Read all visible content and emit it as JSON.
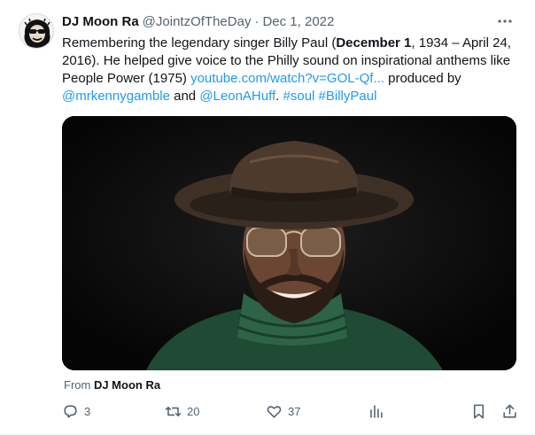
{
  "tweet": {
    "display_name": "DJ Moon Ra",
    "handle": "@JointzOfTheDay",
    "separator": "·",
    "date": "Dec 1, 2022",
    "text": {
      "p1": "Remembering the legendary singer Billy Paul (",
      "bold1": "December 1",
      "p2": ", 1934 – April 24, 2016). He helped give voice to the Philly sound on inspirational anthems like People Power (1975) ",
      "link": "youtube.com/watch?v=GOL-Qf...",
      "p3": " produced by ",
      "mention1": "@mrkennygamble",
      "and": " and ",
      "mention2": "@LeonAHuff",
      "space1": ". ",
      "hashtag1": "#soul",
      "space2": " ",
      "hashtag2": "#BillyPaul"
    },
    "from_prefix": "From ",
    "from_name": "DJ Moon Ra",
    "metrics": {
      "replies": "3",
      "retweets": "20",
      "likes": "37"
    }
  },
  "colors": {
    "link": "#1d9bf0",
    "secondary": "#536471",
    "primary_text": "#0f1419"
  },
  "icons": [
    "more-icon",
    "reply-icon",
    "retweet-icon",
    "like-icon",
    "views-icon",
    "bookmark-icon",
    "share-icon"
  ]
}
